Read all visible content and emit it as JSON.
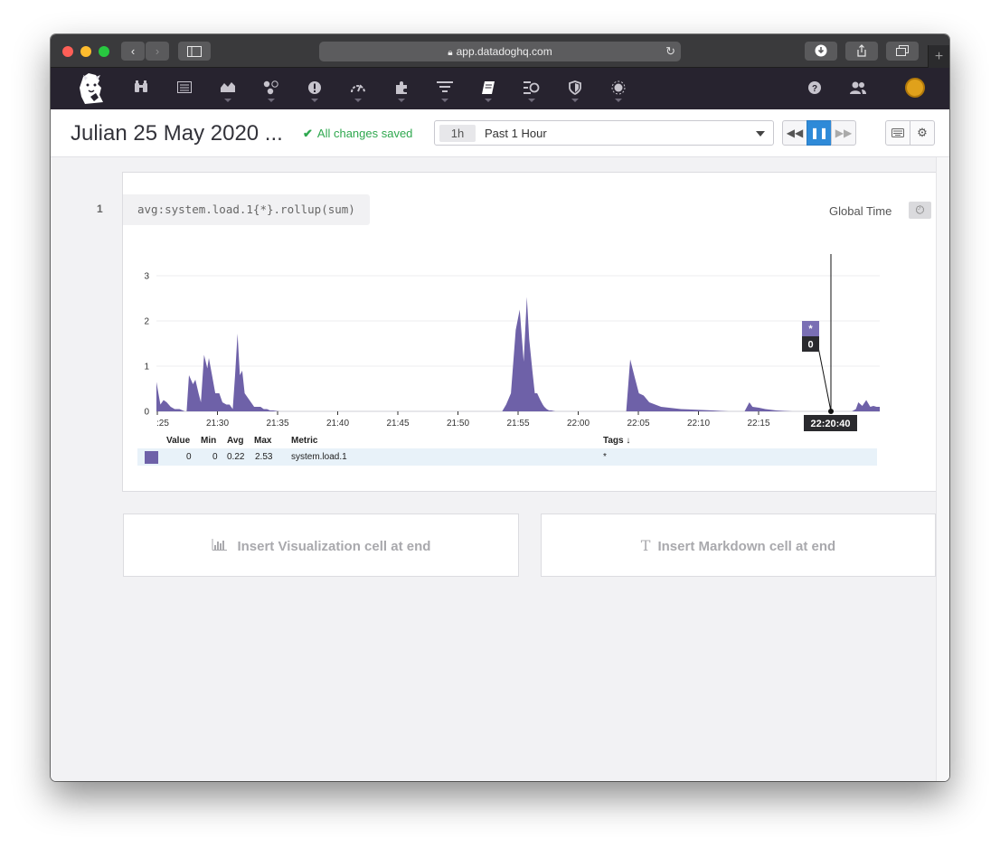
{
  "browser": {
    "url": "app.datadoghq.com"
  },
  "nav": {
    "items": [
      "binoculars-icon",
      "list-icon",
      "area-chart-icon",
      "hexagons-icon",
      "alert-icon",
      "gauge-icon",
      "puzzle-icon",
      "filter-icon",
      "notebook-icon",
      "apm-icon",
      "shield-icon",
      "bug-icon"
    ]
  },
  "notebook": {
    "title": "Julian 25 May 2020 ...",
    "save_status": "All changes saved",
    "time": {
      "chip": "1h",
      "label": "Past 1 Hour"
    }
  },
  "cell": {
    "number": "1",
    "query": "avg:system.load.1{*}.rollup(sum)",
    "global_time_label": "Global Time",
    "tooltip": {
      "series": "*",
      "value": "0",
      "time": "22:20:40"
    },
    "legend": {
      "headers": {
        "value": "Value",
        "min": "Min",
        "avg": "Avg",
        "max": "Max",
        "metric": "Metric",
        "tags": "Tags ↓"
      },
      "row": {
        "value": "0",
        "min": "0",
        "avg": "0.22",
        "max": "2.53",
        "metric": "system.load.1",
        "tags": "*"
      }
    }
  },
  "inserts": {
    "visualization": "Insert Visualization cell at end",
    "markdown": "Insert Markdown cell at end"
  },
  "colors": {
    "series": "#6e61a8",
    "accent": "#2e8ad8",
    "saved": "#2fa84f"
  },
  "chart_data": {
    "type": "area",
    "x_tick_labels": [
      ":25",
      "21:30",
      "21:35",
      "21:40",
      "21:45",
      "21:50",
      "21:55",
      "22:00",
      "22:05",
      "22:10",
      "22:15"
    ],
    "y_tick_labels": [
      "0",
      "1",
      "2",
      "3"
    ],
    "ylim": [
      0,
      3
    ],
    "grid": true,
    "series": [
      {
        "name": "system.load.1",
        "x": [
          0.0,
          0.5,
          0.9,
          1.3,
          1.8,
          2.3,
          2.9,
          3.6,
          3.8,
          4.1,
          4.6,
          4.9,
          5.3,
          5.6,
          6.0,
          6.4,
          6.6,
          7.0,
          7.4,
          7.9,
          8.3,
          8.8,
          9.2,
          9.6,
          9.9,
          10.2,
          10.5,
          10.8,
          11.1,
          11.5,
          11.9,
          12.3,
          12.7,
          13.1,
          13.5,
          13.9,
          14.3,
          14.7,
          15.5,
          20.0,
          25.0,
          30.0,
          35.0,
          40.0,
          43.5,
          44.0,
          44.6,
          45.2,
          45.7,
          46.2,
          46.6,
          46.9,
          47.3,
          47.6,
          47.9,
          48.3,
          48.6,
          48.8,
          49.1,
          49.4,
          49.7,
          50.2,
          50.7,
          51.2,
          51.8,
          52.3,
          53.0,
          54.0,
          55.0,
          56.0,
          57.0,
          57.4,
          57.8,
          58.2,
          58.7,
          59.1,
          59.6,
          60.1,
          60.7,
          61.3,
          62.0,
          63.5,
          66.0,
          70.0,
          72.0,
          74.0,
          74.6,
          75.0,
          75.8,
          76.6,
          78.0,
          80.0,
          84.0,
          86.0,
          87.5,
          88.0,
          88.3,
          88.8,
          89.3,
          89.8,
          90.2,
          90.6,
          91.0
        ],
        "values": [
          0.65,
          0.15,
          0.25,
          0.2,
          0.1,
          0.05,
          0.05,
          0.0,
          0.0,
          0.8,
          0.6,
          0.7,
          0.4,
          0.2,
          1.25,
          0.95,
          1.18,
          0.8,
          0.4,
          0.4,
          0.2,
          0.15,
          0.15,
          0.05,
          0.8,
          1.72,
          0.8,
          0.9,
          0.4,
          0.3,
          0.2,
          0.1,
          0.1,
          0.1,
          0.05,
          0.05,
          0.02,
          0.02,
          0.0,
          0.0,
          0.0,
          0.0,
          0.0,
          0.0,
          0.0,
          0.15,
          0.4,
          1.8,
          2.25,
          1.1,
          2.53,
          1.6,
          0.9,
          0.4,
          0.4,
          0.25,
          0.15,
          0.1,
          0.05,
          0.02,
          0.02,
          0.0,
          0.0,
          0.0,
          0.0,
          0.0,
          0.0,
          0.0,
          0.0,
          0.0,
          0.0,
          0.0,
          0.0,
          0.0,
          0.0,
          0.0,
          1.15,
          0.8,
          0.4,
          0.35,
          0.2,
          0.1,
          0.05,
          0.02,
          0.0,
          0.0,
          0.2,
          0.1,
          0.08,
          0.05,
          0.02,
          0.0,
          0.0,
          0.0,
          0.0,
          0.05,
          0.2,
          0.12,
          0.25,
          0.1,
          0.12,
          0.1,
          0.1
        ]
      }
    ],
    "xlim": [
      0,
      91
    ]
  }
}
